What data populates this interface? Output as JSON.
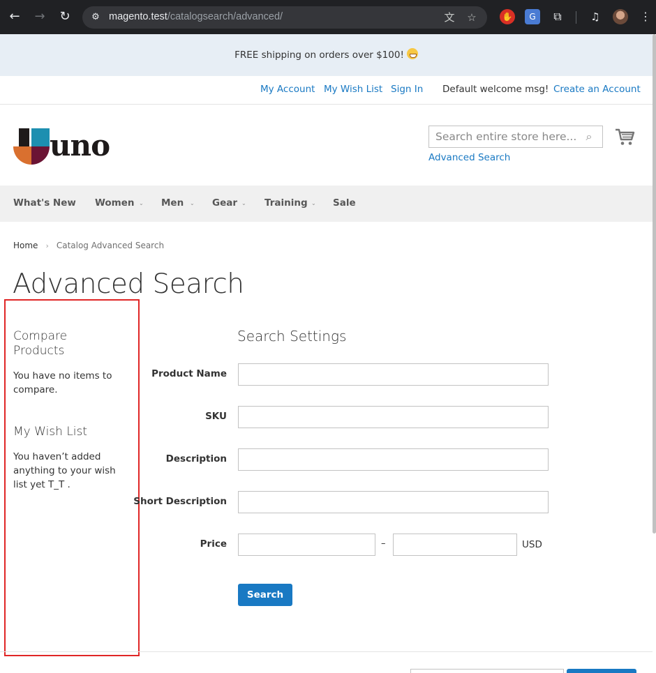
{
  "browser": {
    "url_host": "magento.test",
    "url_path": "/catalogsearch/advanced/",
    "icons": [
      "back-icon",
      "forward-icon",
      "reload-icon",
      "site-settings-icon",
      "translate-icon",
      "bookmark-star-icon",
      "extension-icon",
      "extensions-puzzle-icon",
      "media-icon",
      "profile-avatar"
    ]
  },
  "promo": {
    "text": "FREE shipping on orders over $100!"
  },
  "header_links": {
    "my_account": "My Account",
    "my_wish_list": "My Wish List",
    "sign_in": "Sign In",
    "welcome": "Default welcome msg!",
    "create_account": "Create an Account"
  },
  "logo": {
    "text": "uno"
  },
  "search": {
    "placeholder": "Search entire store here...",
    "advanced_link": "Advanced Search"
  },
  "nav": {
    "items": [
      {
        "label": "What's New"
      },
      {
        "label": "Women"
      },
      {
        "label": "Men"
      },
      {
        "label": "Gear"
      },
      {
        "label": "Training"
      },
      {
        "label": "Sale"
      }
    ]
  },
  "breadcrumb": {
    "home": "Home",
    "current": "Catalog Advanced Search"
  },
  "page_title": "Advanced Search",
  "sidebar": {
    "compare_title_1": "Compare",
    "compare_title_2": "Products",
    "compare_text_1": "You have no items to",
    "compare_text_2": "compare.",
    "wishlist_title": "My Wish List",
    "wishlist_text_1": "You haven’t added",
    "wishlist_text_2": "anything to your wish",
    "wishlist_text_3": "list yet T_T ."
  },
  "form": {
    "title": "Search Settings",
    "fields": {
      "product_name": {
        "label": "Product Name",
        "value": ""
      },
      "sku": {
        "label": "SKU",
        "value": ""
      },
      "description": {
        "label": "Description",
        "value": ""
      },
      "short_description": {
        "label": "Short Description",
        "value": ""
      },
      "price": {
        "label": "Price",
        "from": "",
        "to": "",
        "separator": "–",
        "currency": "USD"
      }
    },
    "submit_label": "Search"
  },
  "colors": {
    "link": "#1979c3",
    "promo_bg": "#e7eef5",
    "nav_bg": "#f0f0f0",
    "highlight": "#e02626",
    "chrome_bg": "#202124"
  }
}
